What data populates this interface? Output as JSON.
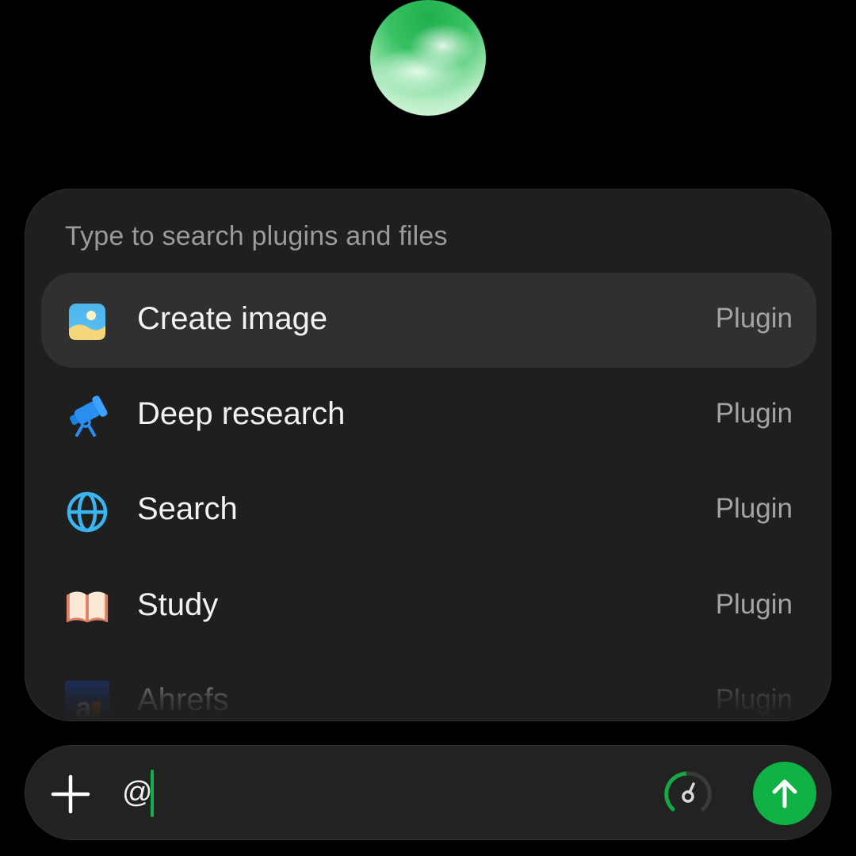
{
  "panel": {
    "header": "Type to search plugins and files",
    "items": [
      {
        "label": "Create image",
        "type": "Plugin",
        "icon": "image-icon"
      },
      {
        "label": "Deep research",
        "type": "Plugin",
        "icon": "telescope-icon"
      },
      {
        "label": "Search",
        "type": "Plugin",
        "icon": "globe-icon"
      },
      {
        "label": "Study",
        "type": "Plugin",
        "icon": "book-icon"
      },
      {
        "label": "Ahrefs",
        "type": "Plugin",
        "icon": "ahrefs-logo-icon"
      }
    ],
    "selected_index": 0
  },
  "composer": {
    "input_value": "@",
    "caret_color": "#12b049",
    "send_color": "#10b246"
  },
  "colors": {
    "background": "#000000",
    "panel": "#1f1f1f",
    "selected_row": "#303030",
    "accent_green": "#10b246"
  }
}
